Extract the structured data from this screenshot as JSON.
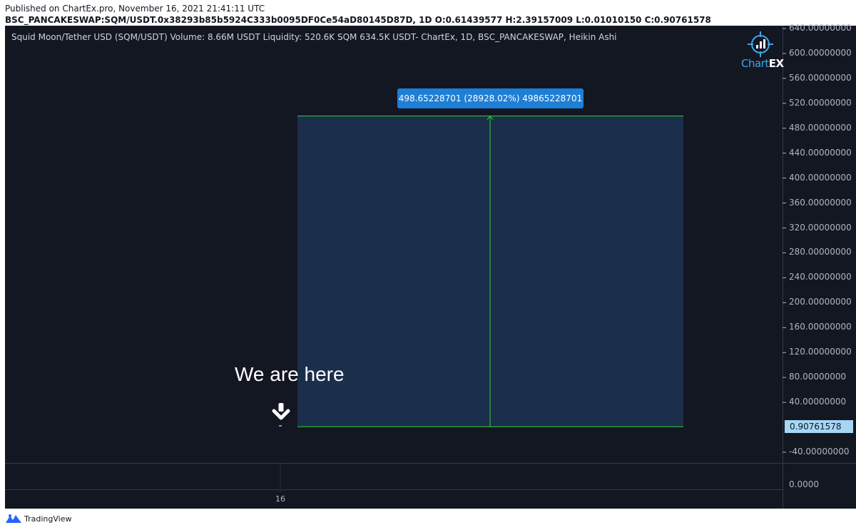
{
  "header": {
    "published": "Published on ChartEx.pro, November 16, 2021 21:41:11 UTC",
    "symbol_line": "BSC_PANCAKESWAP:SQM/USDT.0x38293b85b5924C333b0095DF0Ce54aD80145D87D, 1D O:0.61439577 H:2.39157009 L:0.01010150 C:0.90761578"
  },
  "legend": "Squid Moon/Tether USD (SQM/USDT) Volume: 8.66M USDT Liquidity: 520.6K SQM 634.5K USDT- ChartEx, 1D, BSC_PANCAKESWAP, Heikin Ashi",
  "logo": {
    "name": "Chart",
    "accent": "EX",
    "color": "#3fa4e8"
  },
  "current_price_label": "0.90761578",
  "measure_label": "498.65228701 (28928.02%) 49865228701",
  "annotation": "We are here",
  "date_label": "16",
  "secondary_axis_label": "0.0000",
  "footer": {
    "brand": "TradingView"
  },
  "colors": {
    "background": "#131722",
    "measure_fill": "#1b2e4b",
    "measure_line": "#2bd52b",
    "tooltip": "#1e7fd6",
    "price_label_bg": "#a6d6f5"
  },
  "chart_data": {
    "type": "line",
    "title": "Squid Moon/Tether USD (SQM/USDT)",
    "interval": "1D",
    "style": "Heikin Ashi",
    "ohlc": {
      "open": 0.61439577,
      "high": 2.39157009,
      "low": 0.0101015,
      "close": 0.90761578
    },
    "y_ticks": [
      640,
      600,
      560,
      520,
      480,
      440,
      400,
      360,
      320,
      280,
      240,
      200,
      160,
      120,
      80,
      40,
      -40
    ],
    "ylim": [
      -56,
      640
    ],
    "current_price": 0.90761578,
    "measure": {
      "from_price": 0.90761578,
      "to_price": 499.56,
      "change": 498.65228701,
      "percent": 28928.02
    },
    "x_labels": [
      "16"
    ]
  }
}
